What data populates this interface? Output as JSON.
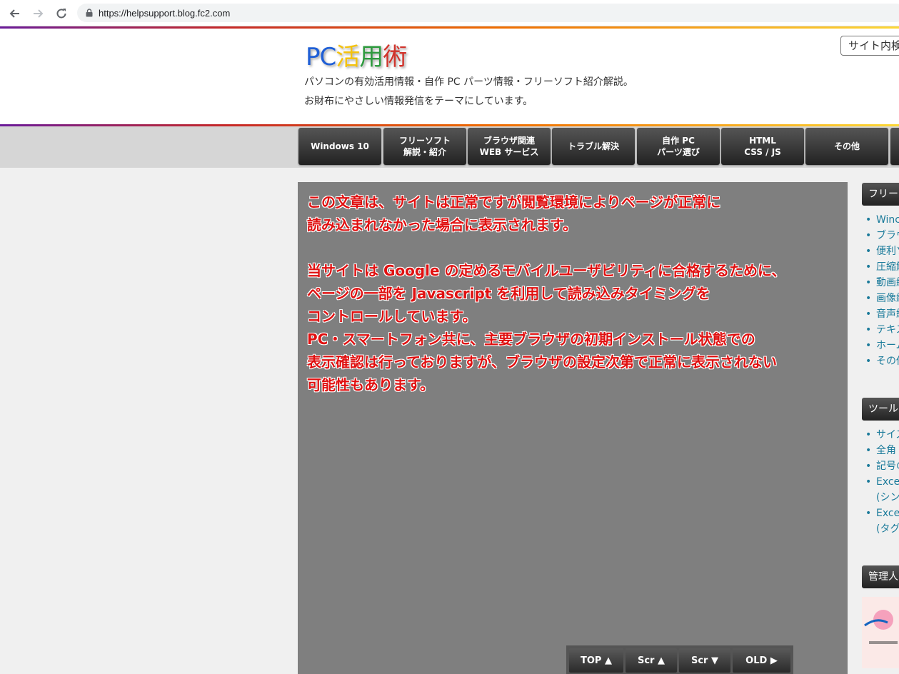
{
  "browser": {
    "url": "https://helpsupport.blog.fc2.com"
  },
  "header": {
    "logo_parts": [
      "PC",
      "活",
      "用",
      "術"
    ],
    "tagline_1": "パソコンの有効活用情報・自作 PC パーツ情報・フリーソフト紹介解説。",
    "tagline_2": "お財布にやさしい情報発信をテーマにしています。",
    "search_label": "サイト内検"
  },
  "nav": {
    "items": [
      {
        "line1": "Windows 10",
        "line2": ""
      },
      {
        "line1": "フリーソフト",
        "line2": "解説・紹介"
      },
      {
        "line1": "ブラウザ関連",
        "line2": "WEB サービス"
      },
      {
        "line1": "トラブル解決",
        "line2": ""
      },
      {
        "line1": "自作 PC",
        "line2": "パーツ選び"
      },
      {
        "line1": "HTML",
        "line2": "CSS / JS"
      },
      {
        "line1": "その他",
        "line2": ""
      }
    ]
  },
  "main": {
    "lines": [
      "この文章は、サイトは正常ですが閲覧環境によりページが正常に",
      "読み込まれなかった場合に表示されます。",
      "当サイトは Google の定めるモバイルユーザビリティに合格するために、",
      "ページの一部を Javascript を利用して読み込みタイミングを",
      "コントロールしています。",
      "PC・スマートフォン共に、主要ブラウザの初期インストール状態での",
      "表示確認は行っておりますが、ブラウザの設定次第で正常に表示されない",
      "可能性もあります。"
    ]
  },
  "bottom_buttons": {
    "top": "TOP ▲",
    "scr_up": "Scr ▲",
    "scr_down": "Scr ▼",
    "old": "OLD ▶"
  },
  "sidebar": {
    "section1_title": "フリー",
    "section1_items": [
      "Winc",
      "ブラウ",
      "便利ソ",
      "圧縮解",
      "動画編",
      "画像編",
      "音声編",
      "テキス",
      "ホーム",
      "その他"
    ],
    "section2_title": "ツール",
    "section2_items": [
      "サイズ",
      "全角",
      "記号の",
      "Exce",
      "(シン",
      "Exce",
      "(タグ"
    ],
    "section3_title": "管理人"
  },
  "colors": {
    "message_red": "#e01010",
    "main_bg": "#7f7f7f",
    "link_teal": "#1a7a9a"
  }
}
